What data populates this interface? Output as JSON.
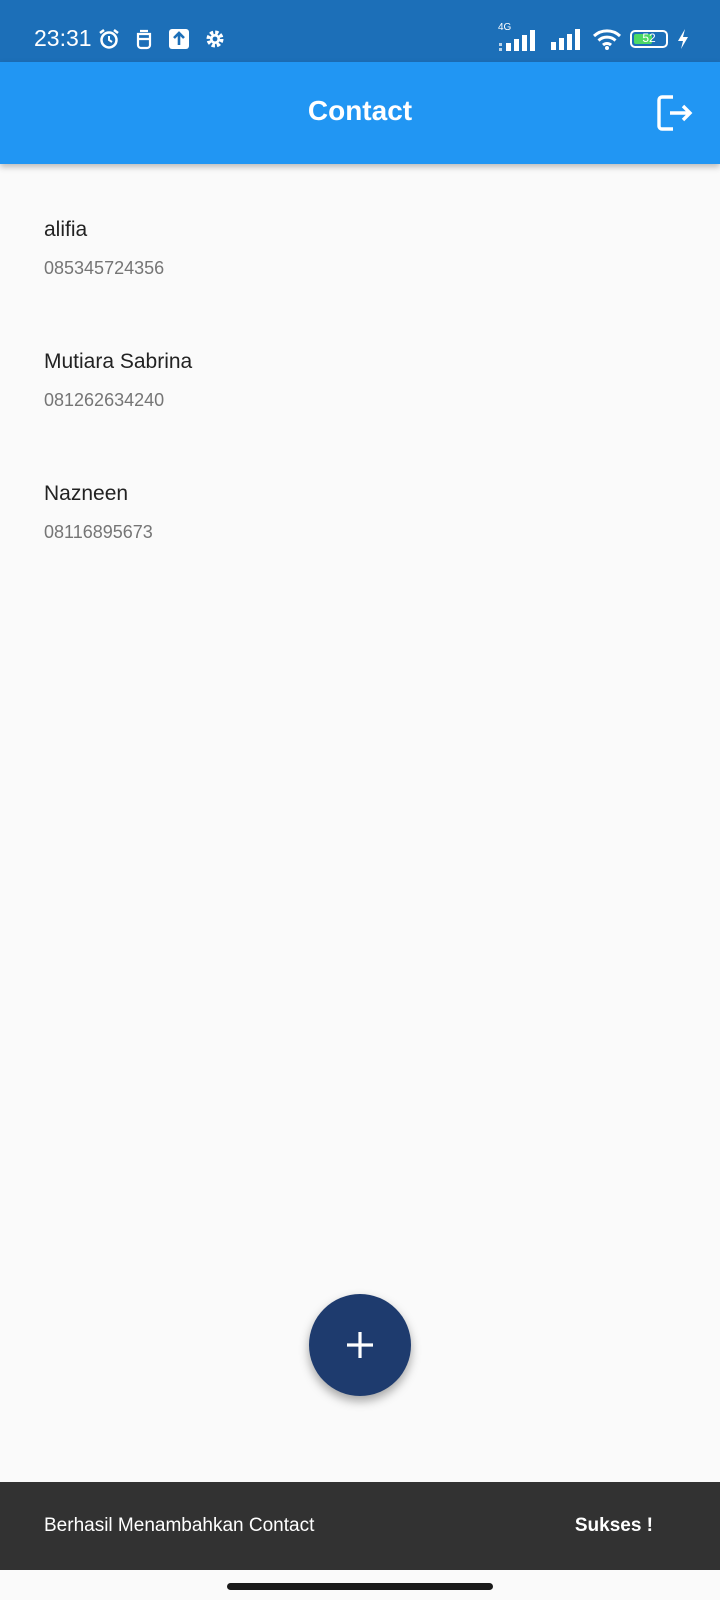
{
  "status_bar": {
    "time": "23:31",
    "network_type": "4G",
    "battery_level": "52",
    "left_icons": [
      "alarm-icon",
      "mascot-icon",
      "upload-icon",
      "settings-gear-icon"
    ],
    "right_icons": [
      "signal-4g-icon",
      "signal-icon",
      "wifi-icon",
      "battery-icon",
      "charging-bolt-icon"
    ]
  },
  "app_bar": {
    "title": "Contact",
    "action_icon": "logout-icon",
    "background_color": "#2196f3"
  },
  "contacts": [
    {
      "name": "alifia",
      "phone": "085345724356"
    },
    {
      "name": "Mutiara Sabrina",
      "phone": "081262634240"
    },
    {
      "name": "Nazneen",
      "phone": "08116895673"
    }
  ],
  "fab": {
    "icon": "plus-icon",
    "color": "#1e3b6e"
  },
  "snackbar": {
    "message": "Berhasil Menambahkan Contact",
    "action": "Sukses !"
  }
}
